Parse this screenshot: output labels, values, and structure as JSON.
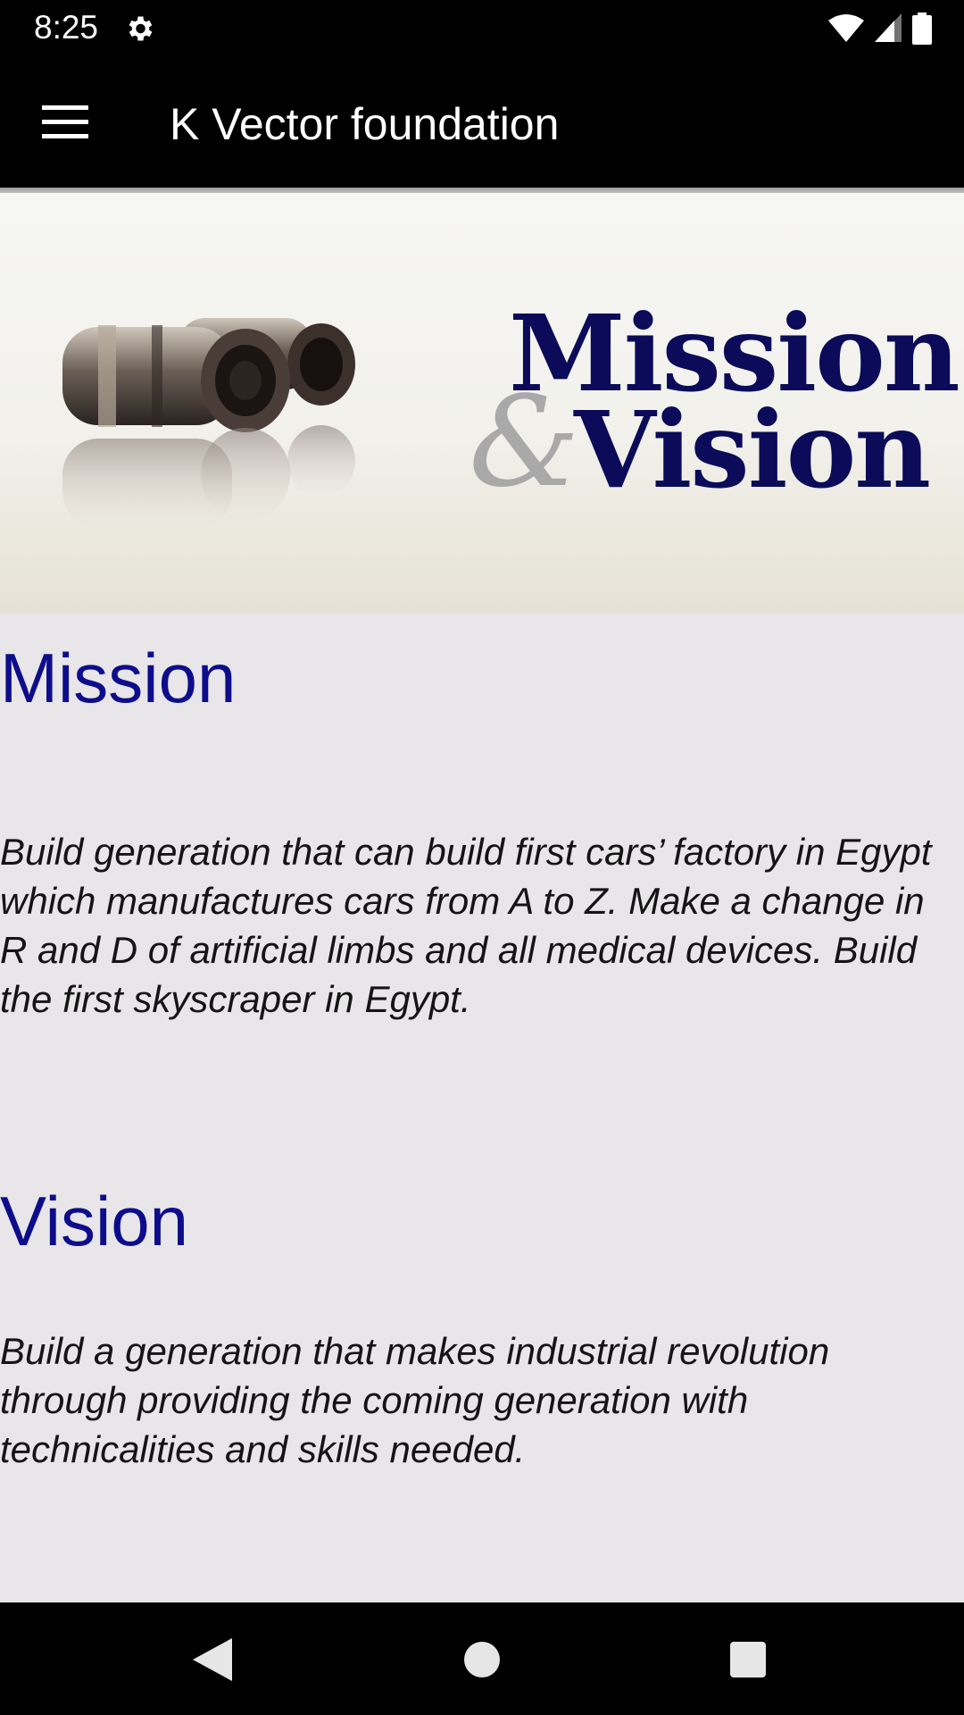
{
  "status_bar": {
    "time": "8:25",
    "icons": [
      "settings-icon",
      "wifi-icon",
      "cell-signal-icon",
      "battery-icon"
    ]
  },
  "app_bar": {
    "title": "K Vector foundation",
    "menu_icon": "hamburger-menu-icon"
  },
  "banner": {
    "line1": "Mission",
    "ampersand": "&",
    "line2": "Vision",
    "image": "binoculars-image"
  },
  "mission": {
    "heading": "Mission",
    "text": "Build generation that can build first cars’ factory in Egypt which manufactures cars from A to Z. Make a change in R and D of artificial limbs and all medical devices. Build the first skyscraper in Egypt."
  },
  "vision": {
    "heading": "Vision",
    "text": "Build a generation that makes industrial revolution through providing the coming generation with technicalities and skills needed."
  },
  "nav_bar": {
    "buttons": [
      "back-icon",
      "home-icon",
      "recents-icon"
    ]
  },
  "colors": {
    "heading": "#0d0d8c",
    "banner_text": "#0b0b5a",
    "app_bar": "#000000",
    "background": "#e8e6e8"
  }
}
